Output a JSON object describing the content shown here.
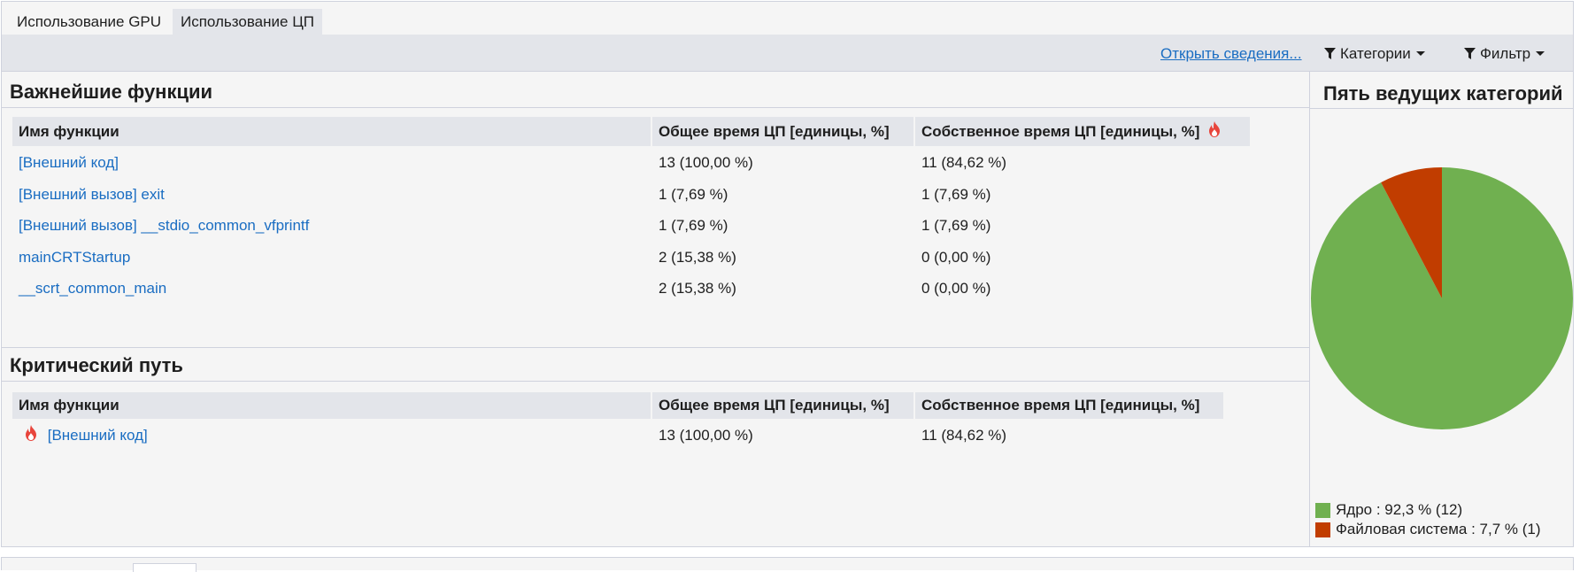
{
  "tabs": [
    {
      "label": "Использование GPU",
      "active": false
    },
    {
      "label": "Использование ЦП",
      "active": true
    }
  ],
  "toolbar": {
    "open_details": "Открыть сведения...",
    "categories": "Категории",
    "filter": "Фильтр"
  },
  "hot_functions": {
    "title": "Важнейшие функции",
    "columns": [
      "Имя функции",
      "Общее время ЦП [единицы, %]",
      "Собственное время ЦП [единицы, %]"
    ],
    "rows": [
      {
        "name": "[Внешний код]",
        "total": "13 (100,00 %)",
        "self": "11 (84,62 %)"
      },
      {
        "name": "[Внешний вызов] exit",
        "total": "1 (7,69 %)",
        "self": "1 (7,69 %)"
      },
      {
        "name": "[Внешний вызов] __stdio_common_vfprintf",
        "total": "1 (7,69 %)",
        "self": "1 (7,69 %)"
      },
      {
        "name": "mainCRTStartup",
        "total": "2 (15,38 %)",
        "self": "0 (0,00 %)"
      },
      {
        "name": "__scrt_common_main",
        "total": "2 (15,38 %)",
        "self": "0 (0,00 %)"
      }
    ]
  },
  "hot_path": {
    "title": "Критический путь",
    "columns": [
      "Имя функции",
      "Общее время ЦП [единицы, %]",
      "Собственное время ЦП [единицы, %]"
    ],
    "rows": [
      {
        "name": "[Внешний код]",
        "total": "13 (100,00 %)",
        "self": "11 (84,62 %)"
      }
    ]
  },
  "top_categories": {
    "title": "Пять ведущих категорий",
    "legend": [
      {
        "label": "Ядро : 92,3 % (12)",
        "color": "#70b050"
      },
      {
        "label": "Файловая система : 7,7 % (1)",
        "color": "#c13d00"
      }
    ]
  },
  "chart_data": {
    "type": "pie",
    "title": "Пять ведущих категорий",
    "categories": [
      "Ядро",
      "Файловая система"
    ],
    "values": [
      92.3,
      7.7
    ],
    "counts": [
      12,
      1
    ],
    "colors": [
      "#70b050",
      "#c13d00"
    ],
    "legend_position": "bottom-left"
  }
}
